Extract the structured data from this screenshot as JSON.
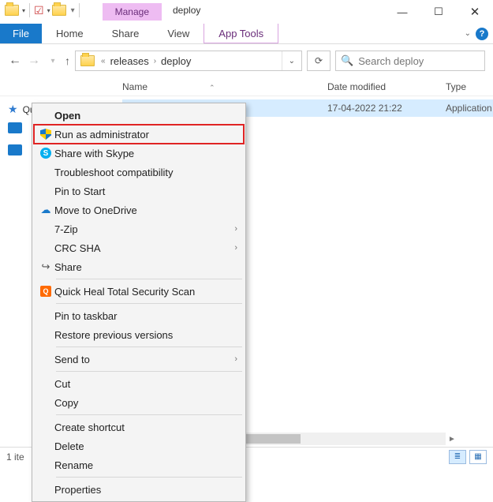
{
  "title": {
    "contextual_tab": "Manage",
    "window_title": "deploy"
  },
  "ribbon": {
    "file": "File",
    "home": "Home",
    "share": "Share",
    "view": "View",
    "app_tools": "App Tools"
  },
  "addressbar": {
    "crumb1": "releases",
    "crumb2": "deploy"
  },
  "search": {
    "placeholder": "Search deploy"
  },
  "columns": {
    "name": "Name",
    "date": "Date modified",
    "type": "Type"
  },
  "sidebar": {
    "quick_access": "Quick access"
  },
  "file_row": {
    "name": "",
    "date": "17-04-2022 21:22",
    "type": "Application"
  },
  "context_menu": {
    "open": "Open",
    "run_admin": "Run as administrator",
    "share_skype": "Share with Skype",
    "troubleshoot": "Troubleshoot compatibility",
    "pin_start": "Pin to Start",
    "onedrive": "Move to OneDrive",
    "sevenzip": "7-Zip",
    "crc": "CRC SHA",
    "share": "Share",
    "quickheal": "Quick Heal Total Security Scan",
    "pin_taskbar": "Pin to taskbar",
    "restore": "Restore previous versions",
    "send_to": "Send to",
    "cut": "Cut",
    "copy": "Copy",
    "create_shortcut": "Create shortcut",
    "delete": "Delete",
    "rename": "Rename",
    "properties": "Properties"
  },
  "status": {
    "items": "1 ite"
  }
}
